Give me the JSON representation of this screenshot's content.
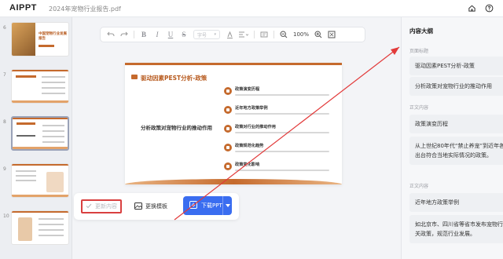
{
  "app": {
    "logo": "AIPPT",
    "doc_title": "2024年宠物行业报告.pdf",
    "icons": {
      "home": "home-icon",
      "help": "help-circle-icon"
    }
  },
  "thumbnails": [
    {
      "num": "6",
      "title": "中国宠物行业发展报告",
      "kind": "cover"
    },
    {
      "num": "7",
      "kind": "content"
    },
    {
      "num": "8",
      "kind": "content",
      "active": true
    },
    {
      "num": "9",
      "kind": "illustration"
    },
    {
      "num": "10",
      "kind": "content"
    }
  ],
  "toolbar": {
    "undo_icon": "undo-icon",
    "redo_icon": "redo-icon",
    "bold": "B",
    "italic": "I",
    "underline": "U",
    "strike": "S",
    "font_placeholder": "字号",
    "zoom": "100%"
  },
  "slide": {
    "title": "驱动因素PEST分析-政策",
    "left_heading": "分析政策对宠物行业的推动作用",
    "items": [
      {
        "heading": "政策演变历程"
      },
      {
        "heading": "近年地方政策举例"
      },
      {
        "heading": "政策对行业的推动作用"
      },
      {
        "heading": "政策规范化趋势"
      },
      {
        "heading": "政策变化影响"
      }
    ]
  },
  "actions": {
    "update": "更新内容",
    "replace_template": "更换模板",
    "download": "下载PPT"
  },
  "outline": {
    "title": "内容大纲",
    "sections": [
      {
        "label": "页面标题",
        "text": "驱动因素PEST分析-政策"
      },
      {
        "label": "",
        "text": "分析政策对宠物行业的推动作用"
      },
      {
        "label": "正文内容",
        "text": "政策演变历程"
      },
      {
        "label": "",
        "text": "从上世纪80年代“禁止养宠”到近年各地出台符合当地实际情况的政策。"
      },
      {
        "label": "正文内容",
        "text": "近年地方政策举例"
      },
      {
        "label": "",
        "text": "如北京市、四川省等省市发布宠物行业相关政策，规范行业发展。"
      }
    ]
  },
  "colors": {
    "accent_orange": "#c56a2d",
    "primary_blue": "#3a6df0",
    "highlight_red": "#d94040"
  }
}
